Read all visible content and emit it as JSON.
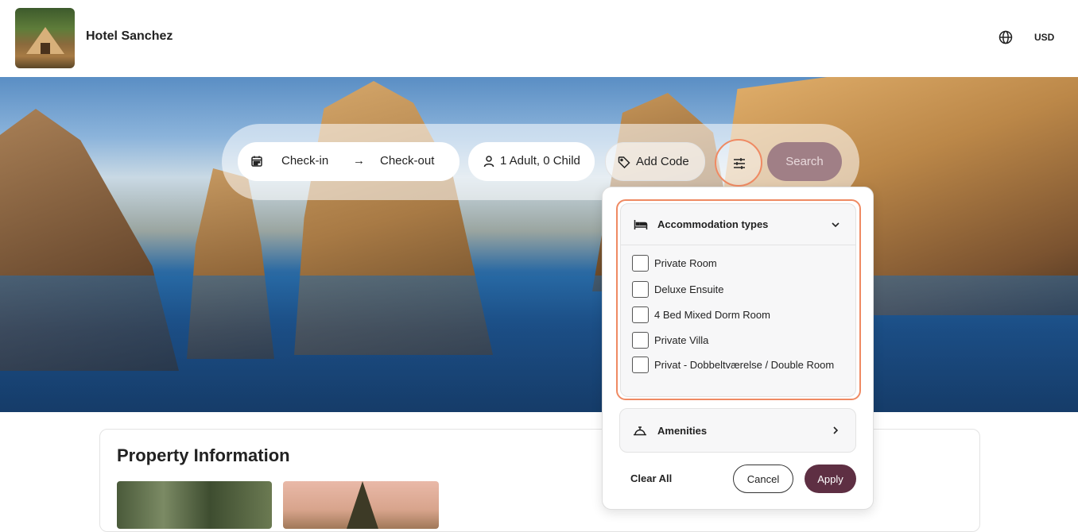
{
  "header": {
    "hotel_name": "Hotel Sanchez",
    "currency": "USD",
    "language_icon": "globe-icon"
  },
  "search": {
    "checkin_label": "Check-in",
    "arrow": "→",
    "checkout_label": "Check-out",
    "guests_label": "1 Adult, 0 Child",
    "code_label": "Add Code",
    "search_label": "Search",
    "icons": {
      "calendar": "calendar-icon",
      "person": "person-icon",
      "tag": "tag-icon",
      "filter": "sliders-icon"
    }
  },
  "filters": {
    "accommodation": {
      "title": "Accommodation types",
      "options": [
        {
          "label": "Private Room",
          "checked": false
        },
        {
          "label": "Deluxe Ensuite",
          "checked": false
        },
        {
          "label": "4 Bed Mixed Dorm Room",
          "checked": false
        },
        {
          "label": "Private Villa",
          "checked": false
        },
        {
          "label": "Privat - Dobbeltværelse / Double Room",
          "checked": false
        }
      ]
    },
    "amenities": {
      "title": "Amenities"
    },
    "clear_label": "Clear All",
    "cancel_label": "Cancel",
    "apply_label": "Apply"
  },
  "property": {
    "title": "Property Information"
  },
  "colors": {
    "accent": "#ef8a63",
    "primary": "#5e2f43",
    "search_disabled": "#a07f86"
  }
}
